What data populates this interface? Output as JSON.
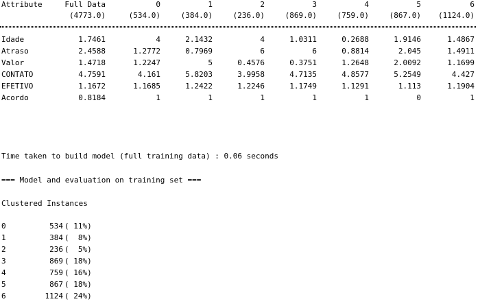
{
  "header": {
    "attribute_label": "Attribute",
    "full_data_label": "Full Data",
    "cluster_ids": [
      "0",
      "1",
      "2",
      "3",
      "4",
      "5",
      "6"
    ],
    "full_data_count": "(4773.0)",
    "cluster_counts": [
      "(534.0)",
      "(384.0)",
      "(236.0)",
      "(869.0)",
      "(759.0)",
      "(867.0)",
      "(1124.0)"
    ]
  },
  "rows": [
    {
      "name": "Idade",
      "full": "1.7461",
      "values": [
        "4",
        "2.1432",
        "4",
        "1.0311",
        "0.2688",
        "1.9146",
        "1.4867"
      ]
    },
    {
      "name": "Atraso",
      "full": "2.4588",
      "values": [
        "1.2772",
        "0.7969",
        "6",
        "6",
        "0.8814",
        "2.045",
        "1.4911"
      ]
    },
    {
      "name": "Valor",
      "full": "1.4718",
      "values": [
        "1.2247",
        "5",
        "0.4576",
        "0.3751",
        "1.2648",
        "2.0092",
        "1.1699"
      ]
    },
    {
      "name": "CONTATO",
      "full": "4.7591",
      "values": [
        "4.161",
        "5.8203",
        "3.9958",
        "4.7135",
        "4.8577",
        "5.2549",
        "4.427"
      ]
    },
    {
      "name": "EFETIVO",
      "full": "1.1672",
      "values": [
        "1.1685",
        "1.2422",
        "1.2246",
        "1.1749",
        "1.1291",
        "1.113",
        "1.1904"
      ]
    },
    {
      "name": "Acordo",
      "full": "0.8184",
      "values": [
        "1",
        "1",
        "1",
        "1",
        "1",
        "0",
        "1"
      ]
    }
  ],
  "time_taken": "Time taken to build model (full training data) : 0.06 seconds",
  "eval_heading": "=== Model and evaluation on training set ===",
  "clustered_heading": "Clustered Instances",
  "clustered": [
    {
      "id": "0",
      "count": "534",
      "pct": "( 11%)"
    },
    {
      "id": "1",
      "count": "384",
      "pct": "(  8%)"
    },
    {
      "id": "2",
      "count": "236",
      "pct": "(  5%)"
    },
    {
      "id": "3",
      "count": "869",
      "pct": "( 18%)"
    },
    {
      "id": "4",
      "count": "759",
      "pct": "( 16%)"
    },
    {
      "id": "5",
      "count": "867",
      "pct": "( 18%)"
    },
    {
      "id": "6",
      "count": "1124",
      "pct": "( 24%)"
    }
  ]
}
